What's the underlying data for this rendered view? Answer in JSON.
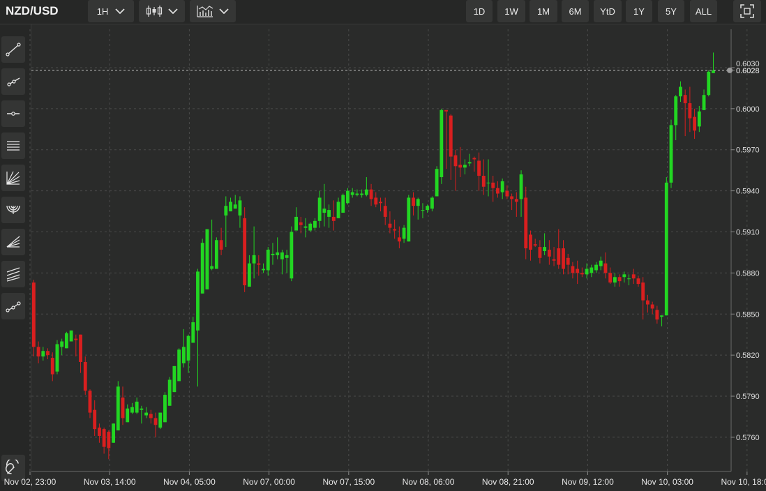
{
  "toolbar": {
    "symbol": "NZD/USD",
    "interval": "1H",
    "ranges": [
      "1D",
      "1W",
      "1M",
      "6M",
      "YtD",
      "1Y",
      "5Y",
      "ALL"
    ]
  },
  "sidebar": {
    "tools": [
      "line-tool-icon",
      "ray-tool-icon",
      "horizontal-line-tool-icon",
      "parallel-channel-tool-icon",
      "pitchfork-tool-icon",
      "arc-tool-icon",
      "fibonacci-fan-tool-icon",
      "fibonacci-retracement-tool-icon",
      "path-tool-icon"
    ],
    "bottom_tool": "magnet-icon"
  },
  "colors": {
    "up": "#22d622",
    "down": "#d91f1f",
    "background": "#2a2b2a",
    "grid": "#4a4b4a"
  },
  "chart_data": {
    "type": "candlestick",
    "y_ticks": [
      "0.5760",
      "0.5790",
      "0.5820",
      "0.5850",
      "0.5880",
      "0.5910",
      "0.5940",
      "0.5970",
      "0.6000",
      "0.6028",
      "0.6030"
    ],
    "ylim": [
      0.5735,
      0.6058
    ],
    "x_ticks": [
      "Nov 02, 23:00",
      "Nov 03, 14:00",
      "Nov 04, 05:00",
      "Nov 07, 00:00",
      "Nov 07, 15:00",
      "Nov 08, 06:00",
      "Nov 08, 21:00",
      "Nov 09, 12:00",
      "Nov 10, 03:00",
      "Nov 10, 18:00"
    ],
    "last_price": 0.6028,
    "candles": [
      [
        0.5873,
        0.5875,
        0.5828,
        0.5826,
        0.5819
      ],
      [
        0.5826,
        0.583,
        0.5818,
        0.5819,
        0.5814
      ],
      [
        0.5819,
        0.5826,
        0.5818,
        0.5823,
        0.5816
      ],
      [
        0.5823,
        0.5825,
        0.5819,
        0.582,
        0.5817
      ],
      [
        0.5818,
        0.5822,
        0.5803,
        0.5806,
        0.5801
      ],
      [
        0.5808,
        0.5831,
        0.5801,
        0.5828,
        0.5806
      ],
      [
        0.5826,
        0.5832,
        0.5819,
        0.583,
        0.582
      ],
      [
        0.5825,
        0.5837,
        0.5829,
        0.5836,
        0.5829
      ],
      [
        0.583,
        0.5838,
        0.5832,
        0.5838,
        0.5831
      ],
      [
        0.5832,
        0.5835,
        0.5824,
        0.5831,
        0.5819
      ],
      [
        0.5835,
        0.5835,
        0.5815,
        0.5815,
        0.5807
      ],
      [
        0.5815,
        0.5819,
        0.5794,
        0.5794,
        0.5791
      ],
      [
        0.5794,
        0.5795,
        0.5776,
        0.5778,
        0.5774
      ],
      [
        0.578,
        0.5787,
        0.5763,
        0.5766,
        0.5761
      ],
      [
        0.5767,
        0.577,
        0.576,
        0.5761,
        0.5756
      ],
      [
        0.5766,
        0.5767,
        0.5751,
        0.5753,
        0.5748
      ],
      [
        0.5764,
        0.5765,
        0.5748,
        0.5752,
        0.5744
      ],
      [
        0.5756,
        0.577,
        0.5763,
        0.577,
        0.576
      ],
      [
        0.5765,
        0.5801,
        0.5778,
        0.5797,
        0.5765
      ],
      [
        0.5789,
        0.5797,
        0.5769,
        0.5774,
        0.5769
      ],
      [
        0.5771,
        0.5784,
        0.5775,
        0.5781,
        0.5774
      ],
      [
        0.5778,
        0.5785,
        0.5777,
        0.5782,
        0.5777
      ],
      [
        0.5778,
        0.5789,
        0.5782,
        0.5786,
        0.5777
      ],
      [
        0.578,
        0.5783,
        0.5777,
        0.5781,
        0.577
      ],
      [
        0.5776,
        0.5782,
        0.5777,
        0.5778,
        0.5774
      ],
      [
        0.5777,
        0.578,
        0.5773,
        0.5774,
        0.577
      ],
      [
        0.5774,
        0.5778,
        0.5768,
        0.5769,
        0.576
      ],
      [
        0.5767,
        0.5778,
        0.577,
        0.5778,
        0.5766
      ],
      [
        0.5771,
        0.5793,
        0.5777,
        0.5791,
        0.5771
      ],
      [
        0.5783,
        0.5804,
        0.5793,
        0.5802,
        0.5791
      ],
      [
        0.5793,
        0.5812,
        0.5802,
        0.5812,
        0.5799
      ],
      [
        0.5801,
        0.5825,
        0.581,
        0.5824,
        0.5808
      ],
      [
        0.5814,
        0.5839,
        0.5819,
        0.5826,
        0.5811
      ],
      [
        0.5816,
        0.5835,
        0.5825,
        0.5834,
        0.5807
      ],
      [
        0.5829,
        0.5848,
        0.5834,
        0.5844,
        0.5829
      ],
      [
        0.5838,
        0.5883,
        0.5841,
        0.5881,
        0.5797
      ],
      [
        0.5865,
        0.5905,
        0.5883,
        0.5902,
        0.5875
      ],
      [
        0.5868,
        0.5912,
        0.5885,
        0.5912,
        0.5872
      ],
      [
        0.5883,
        0.5919,
        0.5911,
        0.5885,
        0.5882
      ],
      [
        0.5883,
        0.5906,
        0.5889,
        0.5904,
        0.5883
      ],
      [
        0.5904,
        0.5913,
        0.5907,
        0.5897,
        0.5893
      ],
      [
        0.5922,
        0.5936,
        0.5913,
        0.5929,
        0.5899
      ],
      [
        0.5925,
        0.5935,
        0.593,
        0.5932,
        0.5927
      ],
      [
        0.5927,
        0.5937,
        0.5931,
        0.593,
        0.5927
      ],
      [
        0.5922,
        0.5936,
        0.5932,
        0.5933,
        0.5913
      ],
      [
        0.592,
        0.5928,
        0.591,
        0.5871,
        0.5866
      ],
      [
        0.587,
        0.5893,
        0.5874,
        0.5887,
        0.5872
      ],
      [
        0.5887,
        0.5914,
        0.5892,
        0.5893,
        0.5876
      ],
      [
        0.5887,
        0.5893,
        0.5882,
        0.5886,
        0.5878
      ],
      [
        0.5882,
        0.5887,
        0.5879,
        0.5883,
        0.588
      ],
      [
        0.5882,
        0.5899,
        0.5888,
        0.5897,
        0.5878
      ],
      [
        0.5893,
        0.5902,
        0.5895,
        0.5894,
        0.5886
      ],
      [
        0.5893,
        0.5906,
        0.5893,
        0.5895,
        0.589
      ],
      [
        0.589,
        0.5897,
        0.5887,
        0.5895,
        0.5879
      ],
      [
        0.5891,
        0.5897,
        0.5889,
        0.5893,
        0.588
      ],
      [
        0.5876,
        0.5914,
        0.5878,
        0.591,
        0.5874
      ],
      [
        0.5911,
        0.5928,
        0.5914,
        0.5921,
        0.5911
      ],
      [
        0.5917,
        0.5921,
        0.5911,
        0.5915,
        0.5909
      ],
      [
        0.5913,
        0.592,
        0.5911,
        0.5914,
        0.5906
      ],
      [
        0.5911,
        0.5917,
        0.5913,
        0.5916,
        0.591
      ],
      [
        0.5913,
        0.592,
        0.5917,
        0.5918,
        0.5911
      ],
      [
        0.5918,
        0.594,
        0.5925,
        0.5935,
        0.5913
      ],
      [
        0.5924,
        0.5945,
        0.5937,
        0.5927,
        0.5914
      ],
      [
        0.5921,
        0.593,
        0.5926,
        0.5926,
        0.5913
      ],
      [
        0.5921,
        0.5933,
        0.5931,
        0.5918,
        0.5911
      ],
      [
        0.592,
        0.5935,
        0.5925,
        0.5932,
        0.5922
      ],
      [
        0.5924,
        0.5938,
        0.5931,
        0.5937,
        0.5929
      ],
      [
        0.5931,
        0.5942,
        0.5936,
        0.594,
        0.593
      ],
      [
        0.5937,
        0.5942,
        0.5936,
        0.5939,
        0.5935
      ],
      [
        0.5937,
        0.5941,
        0.5937,
        0.5938,
        0.5936
      ],
      [
        0.5937,
        0.5941,
        0.5936,
        0.5938,
        0.5935
      ],
      [
        0.5937,
        0.595,
        0.594,
        0.5941,
        0.5936
      ],
      [
        0.5941,
        0.5945,
        0.593,
        0.5934,
        0.5929
      ],
      [
        0.5935,
        0.5939,
        0.5929,
        0.593,
        0.5928
      ],
      [
        0.5932,
        0.5935,
        0.5927,
        0.5931,
        0.5925
      ],
      [
        0.5929,
        0.5935,
        0.5919,
        0.5921,
        0.5915
      ],
      [
        0.5916,
        0.5925,
        0.5911,
        0.5913,
        0.5909
      ],
      [
        0.5912,
        0.5919,
        0.5908,
        0.5911,
        0.5905
      ],
      [
        0.5906,
        0.5914,
        0.5898,
        0.5903,
        0.5898
      ],
      [
        0.5905,
        0.5915,
        0.5908,
        0.5913,
        0.5902
      ],
      [
        0.5903,
        0.5937,
        0.5911,
        0.5935,
        0.5908
      ],
      [
        0.5935,
        0.5939,
        0.5922,
        0.5929,
        0.5922
      ],
      [
        0.5929,
        0.5935,
        0.5923,
        0.5934,
        0.5919
      ],
      [
        0.5926,
        0.5931,
        0.592,
        0.5926,
        0.592
      ],
      [
        0.5926,
        0.593,
        0.5925,
        0.5929,
        0.5924
      ],
      [
        0.5927,
        0.5936,
        0.5928,
        0.5935,
        0.5925
      ],
      [
        0.5936,
        0.5958,
        0.5937,
        0.5956,
        0.5937
      ],
      [
        0.595,
        0.6,
        0.599,
        0.5999,
        0.5945
      ],
      [
        0.5999,
        0.599,
        0.597,
        0.5998,
        0.5956
      ],
      [
        0.5995,
        0.5996,
        0.5963,
        0.5965,
        0.5948
      ],
      [
        0.5966,
        0.597,
        0.5954,
        0.5958,
        0.594
      ],
      [
        0.5959,
        0.5972,
        0.5954,
        0.5957,
        0.595
      ],
      [
        0.5957,
        0.5963,
        0.5956,
        0.5959,
        0.5952
      ],
      [
        0.596,
        0.5967,
        0.5959,
        0.5961,
        0.5958
      ],
      [
        0.5964,
        0.5965,
        0.596,
        0.5963,
        0.5954
      ],
      [
        0.5962,
        0.5968,
        0.5949,
        0.5951,
        0.594
      ],
      [
        0.5951,
        0.5963,
        0.5941,
        0.5943,
        0.5937
      ],
      [
        0.5946,
        0.5963,
        0.5955,
        0.5946,
        0.5936
      ],
      [
        0.5946,
        0.5951,
        0.5938,
        0.5942,
        0.5932
      ],
      [
        0.5942,
        0.5947,
        0.5936,
        0.5938,
        0.5935
      ],
      [
        0.5939,
        0.5949,
        0.5941,
        0.5947,
        0.5934
      ],
      [
        0.594,
        0.5944,
        0.5936,
        0.5936,
        0.5934
      ],
      [
        0.5936,
        0.5938,
        0.5932,
        0.5934,
        0.5926
      ],
      [
        0.5934,
        0.5939,
        0.5928,
        0.5932,
        0.5921
      ],
      [
        0.5934,
        0.5955,
        0.5942,
        0.5952,
        0.5921
      ],
      [
        0.5935,
        0.5943,
        0.5935,
        0.5898,
        0.589
      ],
      [
        0.5908,
        0.5911,
        0.5903,
        0.5897,
        0.5889
      ],
      [
        0.5901,
        0.5905,
        0.59,
        0.59,
        0.5899
      ],
      [
        0.5899,
        0.5904,
        0.5896,
        0.5891,
        0.5887
      ],
      [
        0.5896,
        0.5909,
        0.5898,
        0.5899,
        0.5893
      ],
      [
        0.5897,
        0.5904,
        0.5895,
        0.5892,
        0.5886
      ],
      [
        0.589,
        0.5899,
        0.589,
        0.5889,
        0.5885
      ],
      [
        0.5898,
        0.5912,
        0.5897,
        0.5886,
        0.5883
      ],
      [
        0.5898,
        0.5904,
        0.589,
        0.5883,
        0.5879
      ],
      [
        0.5891,
        0.5894,
        0.5884,
        0.5886,
        0.5879
      ],
      [
        0.5885,
        0.5888,
        0.5883,
        0.588,
        0.5876
      ],
      [
        0.5883,
        0.5889,
        0.5884,
        0.588,
        0.5872
      ],
      [
        0.588,
        0.5884,
        0.5878,
        0.5879,
        0.5877
      ],
      [
        0.5879,
        0.5887,
        0.588,
        0.5883,
        0.5876
      ],
      [
        0.588,
        0.5886,
        0.588,
        0.5884,
        0.5877
      ],
      [
        0.5882,
        0.5888,
        0.5882,
        0.5886,
        0.588
      ],
      [
        0.5885,
        0.5892,
        0.5886,
        0.5889,
        0.5882
      ],
      [
        0.5887,
        0.5895,
        0.5887,
        0.588,
        0.5876
      ],
      [
        0.588,
        0.5884,
        0.5876,
        0.5873,
        0.5872
      ],
      [
        0.5873,
        0.588,
        0.5876,
        0.5877,
        0.587
      ],
      [
        0.5877,
        0.5879,
        0.5874,
        0.5874,
        0.587
      ],
      [
        0.5877,
        0.5881,
        0.5876,
        0.5879,
        0.5873
      ],
      [
        0.5876,
        0.5879,
        0.5873,
        0.5876,
        0.5871
      ],
      [
        0.5879,
        0.5883,
        0.5874,
        0.5876,
        0.5872
      ],
      [
        0.5876,
        0.5878,
        0.5873,
        0.5872,
        0.587
      ],
      [
        0.5873,
        0.5877,
        0.5869,
        0.586,
        0.5846
      ],
      [
        0.586,
        0.5864,
        0.5858,
        0.5857,
        0.5851
      ],
      [
        0.5857,
        0.5859,
        0.5853,
        0.5854,
        0.585
      ],
      [
        0.5853,
        0.5856,
        0.5854,
        0.5846,
        0.5843
      ],
      [
        0.5848,
        0.5849,
        0.5846,
        0.5849,
        0.5841
      ],
      [
        0.5849,
        0.595,
        0.5856,
        0.5946,
        0.5849
      ],
      [
        0.5946,
        0.5992,
        0.5958,
        0.5988,
        0.5942
      ],
      [
        0.5988,
        0.601,
        0.5993,
        0.6009,
        0.5977
      ],
      [
        0.6009,
        0.602,
        0.601,
        0.6016,
        0.6005
      ],
      [
        0.601,
        0.6014,
        0.6006,
        0.6004,
        0.598
      ],
      [
        0.6004,
        0.6016,
        0.5988,
        0.5993,
        0.5983
      ],
      [
        0.5994,
        0.6,
        0.5984,
        0.5984,
        0.5978
      ],
      [
        0.5987,
        0.6002,
        0.5995,
        0.5998,
        0.5983
      ],
      [
        0.5999,
        0.6014,
        0.6005,
        0.601,
        0.6002
      ],
      [
        0.601,
        0.6028,
        0.6013,
        0.6027,
        0.6009
      ],
      [
        0.6026,
        0.6041,
        0.6028,
        0.6028,
        0.6026
      ]
    ]
  }
}
